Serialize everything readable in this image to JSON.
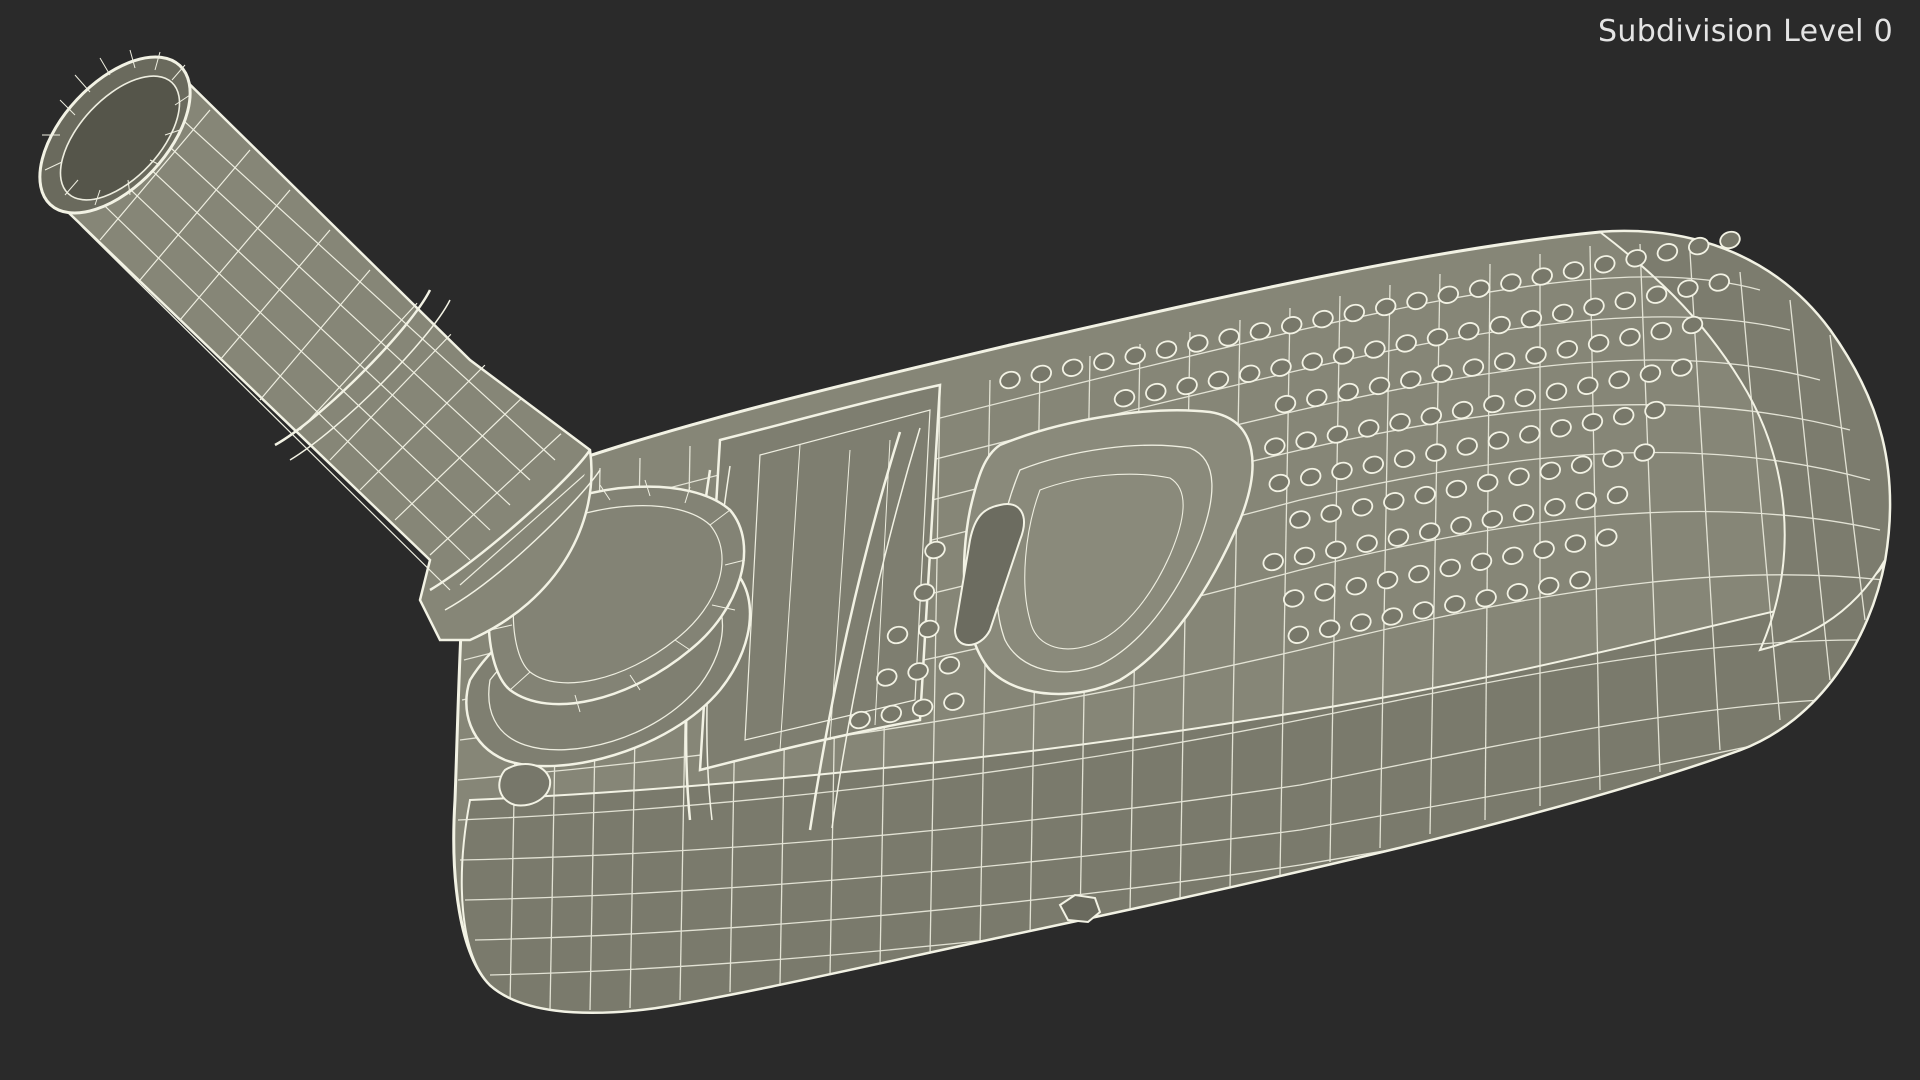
{
  "viewport": {
    "subdivision_label": "Subdivision Level 0",
    "background_color": "#2a2a2a"
  },
  "model": {
    "name": "wireframe-model",
    "surface_color": "#878778",
    "wire_color": "#f2f2e4",
    "shade_color": "#66665a"
  }
}
